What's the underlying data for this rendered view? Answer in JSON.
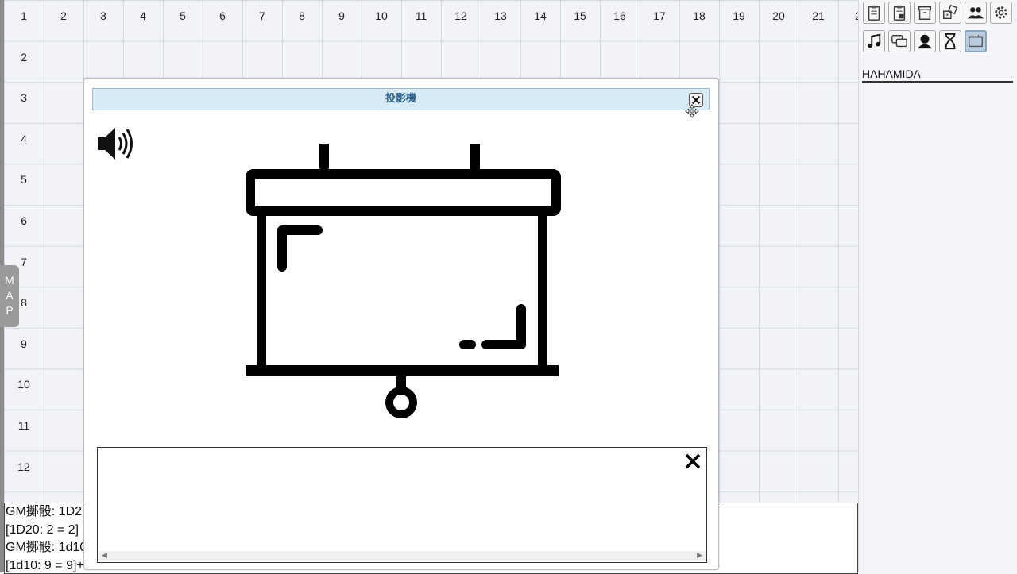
{
  "grid": {
    "columns": [
      "1",
      "2",
      "3",
      "4",
      "5",
      "6",
      "7",
      "8",
      "9",
      "10",
      "11",
      "12",
      "13",
      "14",
      "15",
      "16",
      "17",
      "18",
      "19",
      "20",
      "21",
      "2"
    ],
    "rows": [
      "1",
      "2",
      "3",
      "4",
      "5",
      "6",
      "7",
      "8",
      "9",
      "10",
      "11",
      "12"
    ]
  },
  "map_tab": {
    "letters": [
      "M",
      "A",
      "P"
    ]
  },
  "chat_log": {
    "lines": [
      "GM擲骰: 1D2",
      "[1D20: 2 = 2]",
      "GM擲骰: 1d10",
      "[1d10: 9 = 9]+"
    ]
  },
  "toolbar": {
    "icons": [
      "clipboard-list-icon",
      "clipboard-lock-icon",
      "archive-box-icon",
      "dice-icon",
      "users-icon",
      "gear-icon",
      "music-note-icon",
      "chat-bubbles-icon",
      "character-silhouette-icon",
      "hourglass-icon",
      "projector-icon"
    ],
    "active": "projector-icon"
  },
  "user": {
    "name": "HAHAMIDA"
  },
  "dialog": {
    "title": "投影機",
    "close_icon": "close-icon",
    "speaker_icon": "speaker-icon",
    "caption_close_icon": "close-x-icon"
  },
  "colors": {
    "title_bar": "#d8ecf7",
    "title_text": "#2a5f86",
    "active_tool": "#b9cde0"
  }
}
